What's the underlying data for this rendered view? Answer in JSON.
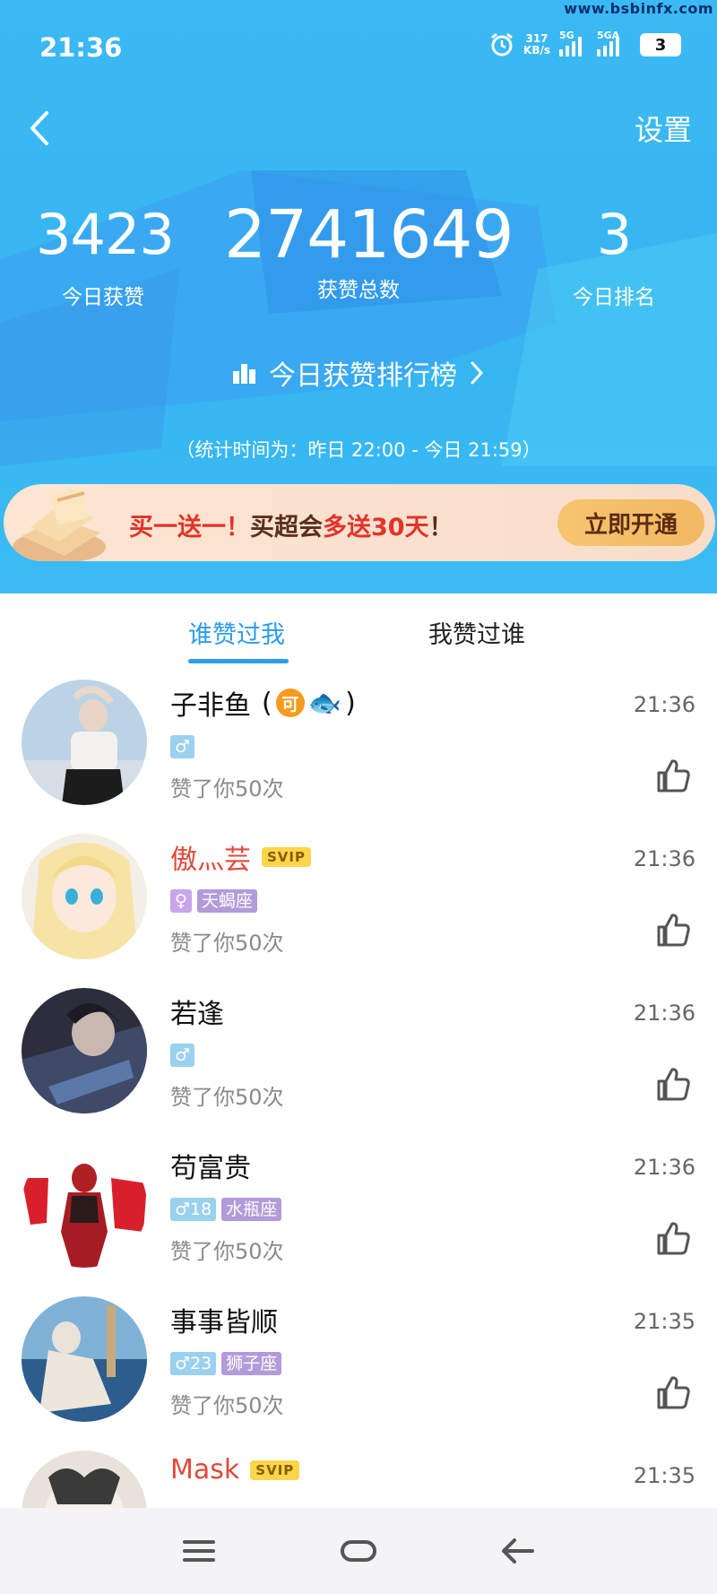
{
  "watermark": "www.bsbinfx.com",
  "status_bar": {
    "time": "21:36",
    "net_speed_value": "317",
    "net_speed_unit": "KB/s",
    "signal1_label": "5G",
    "signal2_label": "5GA",
    "battery": "3",
    "icons": [
      "alarm-icon",
      "signal-icon",
      "battery-icon"
    ]
  },
  "header": {
    "back_icon": "back-icon",
    "settings_label": "设置",
    "colors": {
      "background": "#3bb9f3",
      "accent": "#2b9cf0"
    }
  },
  "stats": [
    {
      "value": "3423",
      "label": "今日获赞"
    },
    {
      "value": "2741649",
      "label": "获赞总数"
    },
    {
      "value": "3",
      "label": "今日排名"
    }
  ],
  "ranking_link": {
    "label": "今日获赞排行榜",
    "icon": "bar-chart-icon"
  },
  "stat_period": "（统计时间为：昨日 22:00 - 今日 21:59）",
  "promo": {
    "text_part1": "买一送一！",
    "text_part2": "买超会",
    "text_part3": "多送30天",
    "text_part4": "！",
    "cta_label": "立即开通"
  },
  "tabs": [
    {
      "label": "谁赞过我",
      "active": true
    },
    {
      "label": "我赞过谁",
      "active": false
    }
  ],
  "likes": [
    {
      "name": "子非鱼",
      "name_suffix_open": "(",
      "coin": "可",
      "fish": "🐟",
      "name_suffix_close": ")",
      "svip": "",
      "gender_badge": "♂",
      "zodiac": "",
      "liked": "赞了你50次",
      "time": "21:36",
      "avatar": "avatar-photo-girl"
    },
    {
      "name": "傲灬芸",
      "svip": "SVIP",
      "gender_badge": "♀",
      "zodiac": "天蝎座",
      "liked": "赞了你50次",
      "time": "21:36",
      "avatar": "avatar-anime-girl"
    },
    {
      "name": "若逢",
      "svip": "",
      "gender_badge": "♂",
      "zodiac": "",
      "liked": "赞了你50次",
      "time": "21:36",
      "avatar": "avatar-anime-dark"
    },
    {
      "name": "苟富贵",
      "svip": "",
      "gender_badge": "♂18",
      "zodiac": "水瓶座",
      "liked": "赞了你50次",
      "time": "21:36",
      "avatar": "avatar-ultraman-red"
    },
    {
      "name": "事事皆顺",
      "svip": "",
      "gender_badge": "♂23",
      "zodiac": "狮子座",
      "liked": "赞了你50次",
      "time": "21:35",
      "avatar": "avatar-statue-sea"
    },
    {
      "name": "Mask",
      "svip": "SVIP",
      "gender_badge": "",
      "zodiac": "",
      "liked": "",
      "time": "21:35",
      "avatar": "avatar-dog"
    }
  ],
  "nav_bar": {
    "icons": [
      "menu-icon",
      "home-icon",
      "back-nav-icon"
    ]
  }
}
